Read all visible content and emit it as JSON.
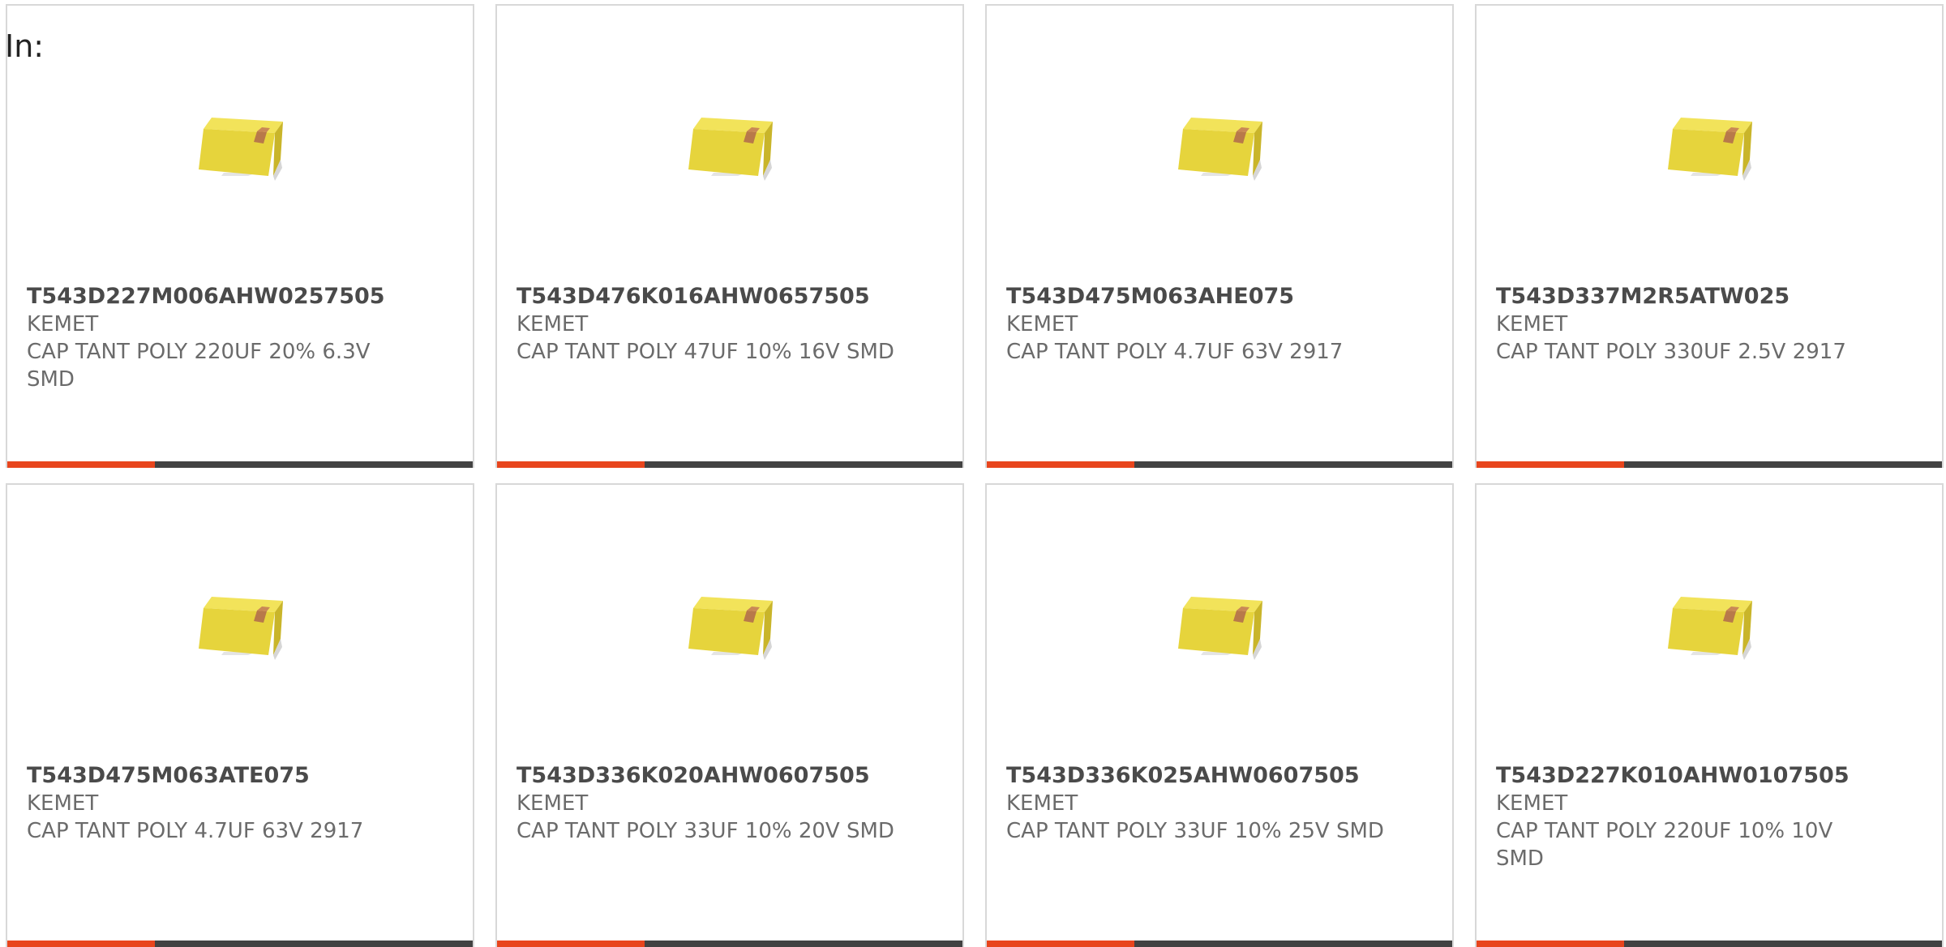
{
  "header": {
    "in_label": "In:"
  },
  "colors": {
    "accent": "#e8451d",
    "bar": "#424242",
    "part_number_text": "#4a4a4a",
    "secondary_text": "#6b6b6b",
    "card_border": "#d8d8d8"
  },
  "product_image_icon": "tantalum-capacitor-icon",
  "products": [
    {
      "part_number": "T543D227M006AHW0257505",
      "manufacturer": "KEMET",
      "description": "CAP TANT POLY 220UF 20% 6.3V SMD"
    },
    {
      "part_number": "T543D476K016AHW0657505",
      "manufacturer": "KEMET",
      "description": "CAP TANT POLY 47UF 10% 16V SMD"
    },
    {
      "part_number": "T543D475M063AHE075",
      "manufacturer": "KEMET",
      "description": "CAP TANT POLY 4.7UF 63V 2917"
    },
    {
      "part_number": "T543D337M2R5ATW025",
      "manufacturer": "KEMET",
      "description": "CAP TANT POLY 330UF 2.5V 2917"
    },
    {
      "part_number": "T543D475M063ATE075",
      "manufacturer": "KEMET",
      "description": "CAP TANT POLY 4.7UF 63V 2917"
    },
    {
      "part_number": "T543D336K020AHW0607505",
      "manufacturer": "KEMET",
      "description": "CAP TANT POLY 33UF 10% 20V SMD"
    },
    {
      "part_number": "T543D336K025AHW0607505",
      "manufacturer": "KEMET",
      "description": "CAP TANT POLY 33UF 10% 25V SMD"
    },
    {
      "part_number": "T543D227K010AHW0107505",
      "manufacturer": "KEMET",
      "description": "CAP TANT POLY 220UF 10% 10V SMD"
    }
  ]
}
